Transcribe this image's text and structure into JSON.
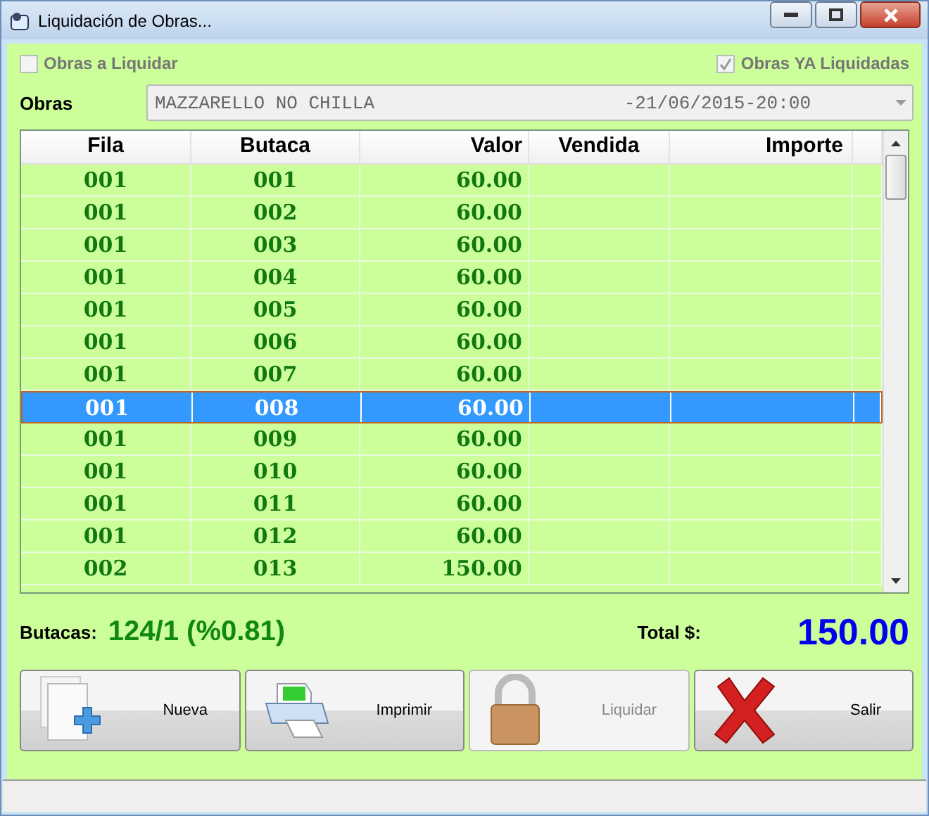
{
  "window": {
    "title": "Liquidación de Obras..."
  },
  "filters": [
    {
      "label": "Obras a Liquidar",
      "checked": false,
      "disabled": true
    },
    {
      "label": "Obras YA Liquidadas",
      "checked": true,
      "disabled": true
    }
  ],
  "obras": {
    "label": "Obras",
    "name": "MAZZARELLO NO CHILLA",
    "date": "-21/06/2015-20:00",
    "disabled": true
  },
  "table": {
    "columns": [
      "Fila",
      "Butaca",
      "Valor",
      "Vendida",
      "Importe"
    ],
    "rows": [
      {
        "cells": [
          "001",
          "001",
          "60.00",
          "",
          ""
        ],
        "selected": false
      },
      {
        "cells": [
          "001",
          "002",
          "60.00",
          "",
          ""
        ],
        "selected": false
      },
      {
        "cells": [
          "001",
          "003",
          "60.00",
          "",
          ""
        ],
        "selected": false
      },
      {
        "cells": [
          "001",
          "004",
          "60.00",
          "",
          ""
        ],
        "selected": false
      },
      {
        "cells": [
          "001",
          "005",
          "60.00",
          "",
          ""
        ],
        "selected": false
      },
      {
        "cells": [
          "001",
          "006",
          "60.00",
          "",
          ""
        ],
        "selected": false
      },
      {
        "cells": [
          "001",
          "007",
          "60.00",
          "",
          ""
        ],
        "selected": false
      },
      {
        "cells": [
          "001",
          "008",
          "60.00",
          "",
          ""
        ],
        "selected": true
      },
      {
        "cells": [
          "001",
          "009",
          "60.00",
          "",
          ""
        ],
        "selected": false
      },
      {
        "cells": [
          "001",
          "010",
          "60.00",
          "",
          ""
        ],
        "selected": false
      },
      {
        "cells": [
          "001",
          "011",
          "60.00",
          "",
          ""
        ],
        "selected": false
      },
      {
        "cells": [
          "001",
          "012",
          "60.00",
          "",
          ""
        ],
        "selected": false
      },
      {
        "cells": [
          "002",
          "013",
          "150.00",
          "",
          ""
        ],
        "selected": false
      }
    ]
  },
  "summary": {
    "seats_label": "Butacas:",
    "seats_value": "124/1 (%0.81)",
    "total_label": "Total $:",
    "total_value": "150.00"
  },
  "buttons": [
    {
      "label": "Nueva",
      "kind": "new",
      "disabled": false
    },
    {
      "label": "Imprimir",
      "kind": "print",
      "disabled": false
    },
    {
      "label": "Liquidar",
      "kind": "lock",
      "disabled": true
    },
    {
      "label": "Salir",
      "kind": "exit",
      "disabled": false
    }
  ]
}
